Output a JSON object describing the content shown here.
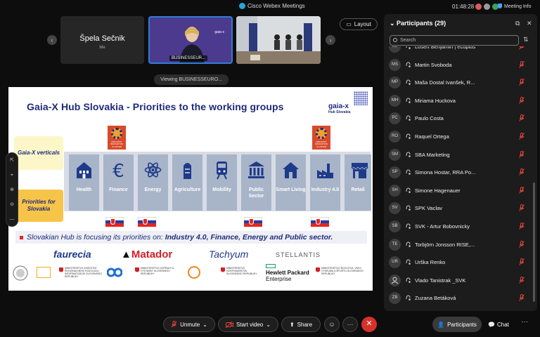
{
  "window": {
    "title": "Cisco Webex Meetings",
    "timer": "01:48:28",
    "meeting_info": "Meeting Info"
  },
  "videos": {
    "self_name": "Špela Sečnik",
    "self_sub": "Me",
    "presenter_label": "BUSINESSEUR...",
    "layout_label": "Layout"
  },
  "viewing": "Viewing BUSINESSEURO...",
  "slide": {
    "title": "Gaia-X Hub Slovakia - Priorities to the working groups",
    "gaia_logo": "gaia-x",
    "gaia_sub": "Hub Slovakia",
    "left_labels": [
      "Gaia-X verticals",
      "Priorities for Slovakia"
    ],
    "sectors": [
      "Health",
      "Finance",
      "Energy",
      "Agriculture",
      "Mobility",
      "Public Sector",
      "Smart Living",
      "Industry 4.0",
      "Retail"
    ],
    "cluster_text": "INDUSTRY INNOVATION CLUSTER",
    "focus_prefix": "Slovakian Hub is focusing its priorities on: ",
    "focus_bold": "Industry 4.0, Finance, Energy and Public sector.",
    "logos": [
      "faurecia",
      "Matador",
      "Tachyum",
      "STELLANTIS"
    ],
    "hpe": [
      "Hewlett Packard",
      "Enterprise"
    ],
    "small_logos": [
      "MINISTERSTVO INVESTÍCIÍ, REGIONÁLNEHO ROZVOJA A INFORMATIZÁCIE SLOVENSKEJ REPUBLIKY",
      "MINISTERSTVO DOPRAVY A VÝSTAVBY SLOVENSKEJ REPUBLIKY",
      "MINISTERSTVO HOSPODÁRSTVA SLOVENSKEJ REPUBLIKY",
      "MINISTERSTVO ŠKOLSTVA, VEDY, VÝSKUMU A ŠPORTU SLOVENSKEJ REPUBLIKY"
    ]
  },
  "participants": {
    "header": "Participants (29)",
    "search_placeholder": "Search",
    "list": [
      {
        "initials": "LE",
        "name": "Losert Benjamin | ecoplus"
      },
      {
        "initials": "MS",
        "name": "Martin Svoboda"
      },
      {
        "initials": "MP",
        "name": "Maša Dostal Ivanšek, R..."
      },
      {
        "initials": "MH",
        "name": "Miriama Huckova"
      },
      {
        "initials": "PC",
        "name": "Paulo Costa"
      },
      {
        "initials": "RO",
        "name": "Raquel Ortega"
      },
      {
        "initials": "SM",
        "name": "SBA Marketing"
      },
      {
        "initials": "SP",
        "name": "Simona Hostar, RRA Po..."
      },
      {
        "initials": "SH",
        "name": "Simone Hagenauer"
      },
      {
        "initials": "SV",
        "name": "SPK Vaclav"
      },
      {
        "initials": "SB",
        "name": "SVK - Artur Bobovnicky"
      },
      {
        "initials": "TE",
        "name": "Torbjörn Jonsson RISE,..."
      },
      {
        "initials": "UR",
        "name": "Urška Renko"
      },
      {
        "initials": "",
        "name": "Vlado Tanistrak _SVK"
      },
      {
        "initials": "ZB",
        "name": "Zuzana Betáková"
      }
    ]
  },
  "controls": {
    "mute": "Unmute",
    "video": "Start video",
    "share": "Share",
    "participants": "Participants",
    "chat": "Chat"
  },
  "colors": {
    "accent": "#2f7dd9",
    "end": "#d6322b",
    "muted": "#d6322b",
    "slide_title": "#1e2a7a"
  }
}
